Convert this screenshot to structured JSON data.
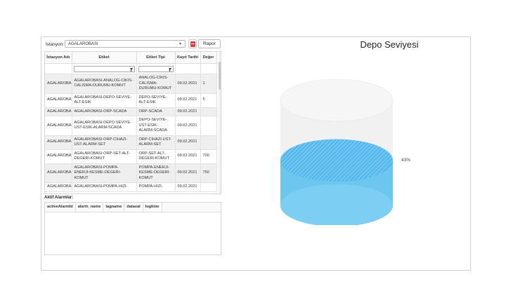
{
  "toolbar": {
    "station_label": "İstasyon:",
    "station_value": "AGALAROBASI",
    "report_label": "Rapor",
    "pdf_icon": "pdf-file-icon"
  },
  "grid": {
    "columns": [
      "İstasyon Adı",
      "Etiket",
      "Etiket Tipi",
      "Kayıt Tarihi",
      "Değer"
    ],
    "rows": [
      [
        "AGALAROBA...",
        "AGALAROBASI-ANALOG-CIKIS-CALISMA-DURUMU-KOMUT",
        "ANALOG-CIKIS-CALISMA-DURUMU-KOMUT",
        "09.02.2021",
        "1"
      ],
      [
        "AGALAROBA...",
        "AGALAROBASI-DEPO-SEVIYE-ALT-ESIK",
        "DEPO-SEVIYE-ALT-ESIK",
        "09.02.2021",
        "5"
      ],
      [
        "AGALAROBA...",
        "AGALAROBASI-ORP-SCADA",
        "ORP-SCADA",
        "09.02.2021",
        ""
      ],
      [
        "AGALAROBA...",
        "AGALAROBASI-DEPO-SEVIYE-UST-ESIK-ALARM-SCADA",
        "DEPO-SEVIYE-UST-ESIK-ALARM-SCADA",
        "09.02.2021",
        ""
      ],
      [
        "AGALAROBA...",
        "AGALAROBASI-ORP-CIHAZI-UST-ALARM-SET",
        "ORP-CIHAZI-UST-ALARM-SET",
        "09.02.2021",
        ""
      ],
      [
        "AGALAROBA...",
        "AGALAROBASI-ORP-SET-ALT-DEGERI-KOMUT",
        "ORP-SET-ALT-DEGERI-KOMUT",
        "09.02.2021",
        "700"
      ],
      [
        "AGALAROBA...",
        "AGALAROBASI-POMPA-ENERJI-KESME-DEGERI-KOMUT",
        "POMPA-ENERJI-KESME-DEGERI-KOMUT",
        "09.02.2021",
        "750"
      ],
      [
        "AGALAROBA...",
        "AGALAROBASI-POMPA-HIZI-",
        "POMPA-HIZI-",
        "09.02.2021",
        ""
      ]
    ]
  },
  "alarms": {
    "label": "Aktif Alarmlar:",
    "columns": [
      "activeAlarmId",
      "alarm_name",
      "tagname",
      "dataval",
      "logtime"
    ]
  },
  "chart": {
    "title": "Depo Seviyesi",
    "level_label": "43%"
  },
  "chart_data": {
    "type": "gauge",
    "title": "Depo Seviyesi",
    "value": 43,
    "unit": "%",
    "range": [
      0,
      100
    ],
    "colors": {
      "fill": "#6cc6ee",
      "empty": "#f1f1f1",
      "surface": "#55b8ee"
    }
  }
}
